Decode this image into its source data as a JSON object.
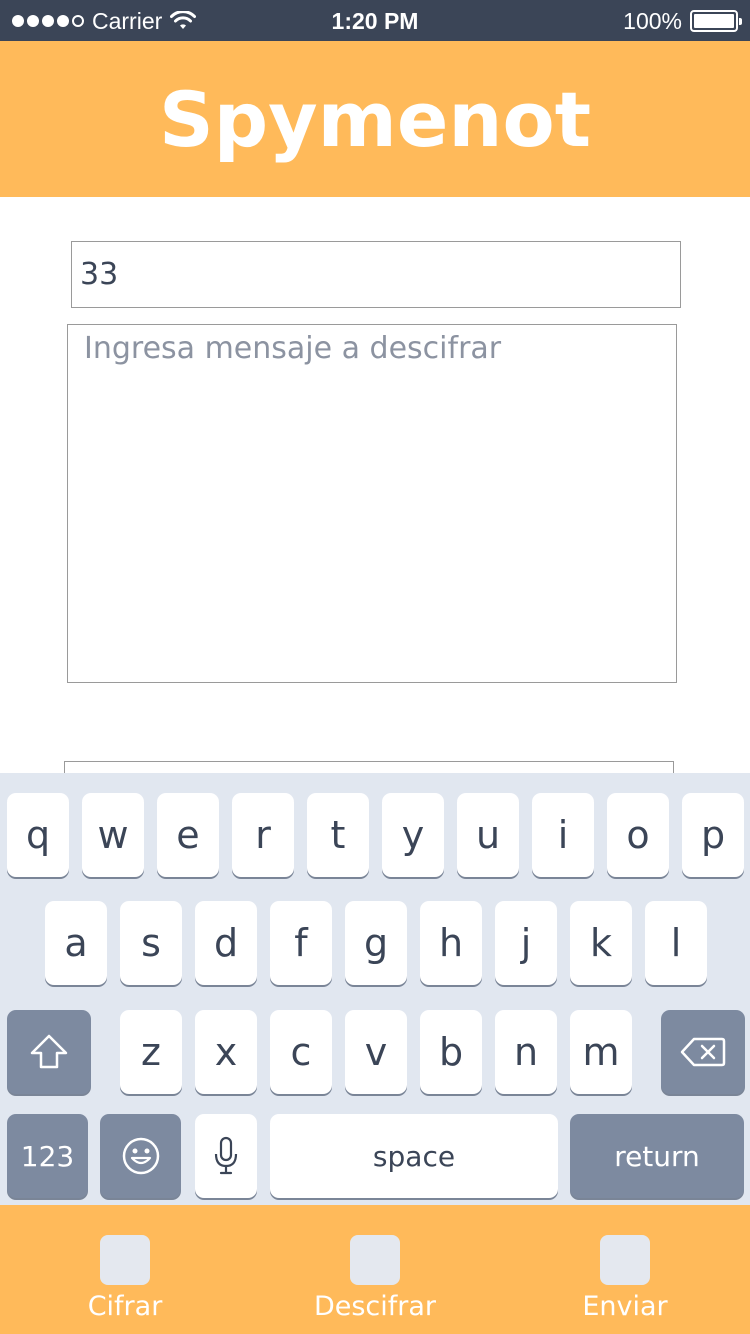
{
  "status_bar": {
    "carrier": "Carrier",
    "time": "1:20 PM",
    "battery_percent": "100%",
    "battery_level": 1.0,
    "signal_bars": 4,
    "signal_total": 5
  },
  "header": {
    "title": "Spymenot",
    "background_color": "#ffba5a"
  },
  "form": {
    "key_value": "33",
    "message_placeholder": "Ingresa mensaje a descifrar",
    "message_value": ""
  },
  "keyboard": {
    "row1": [
      "q",
      "w",
      "e",
      "r",
      "t",
      "y",
      "u",
      "i",
      "o",
      "p"
    ],
    "row2": [
      "a",
      "s",
      "d",
      "f",
      "g",
      "h",
      "j",
      "k",
      "l"
    ],
    "row3": [
      "z",
      "x",
      "c",
      "v",
      "b",
      "n",
      "m"
    ],
    "numbers_label": "123",
    "space_label": "space",
    "return_label": "return",
    "shift_icon": "shift-arrow-icon",
    "delete_icon": "backspace-icon",
    "emoji_icon": "emoji-icon",
    "mic_icon": "microphone-icon"
  },
  "tabs": [
    {
      "label": "Cifrar",
      "icon": "cipher-icon"
    },
    {
      "label": "Descifrar",
      "icon": "decipher-icon"
    },
    {
      "label": "Enviar",
      "icon": "send-icon"
    }
  ]
}
